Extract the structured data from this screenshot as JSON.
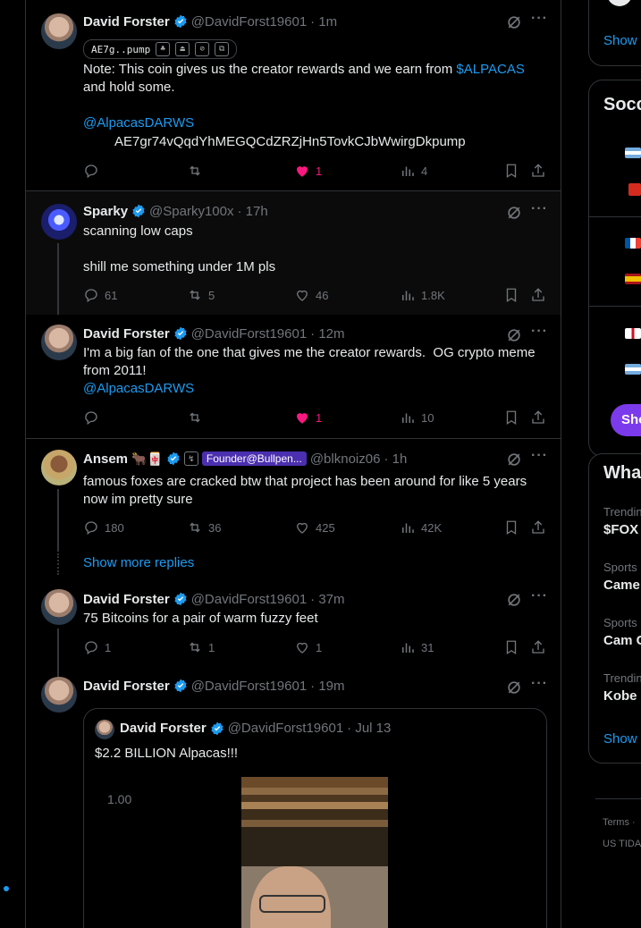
{
  "feed": {
    "tweets": [
      {
        "name": "David Forster",
        "handle": "@DavidForst19601",
        "time": "· 1m",
        "pump_label": "AE7g..pump",
        "text1": "Note: This coin gives us the creator rewards and we earn from ",
        "text1_link": "$ALPACAS",
        "text1_end": "and hold some.",
        "mention": "@AlpacasDARWS",
        "contract": "AE7gr74vQqdYhMEGQCdZRZjHn5TovkCJbWwirgDkpump",
        "replies": "",
        "reposts": "",
        "likes": "1",
        "views": "4"
      },
      {
        "name": "Sparky",
        "handle": "@Sparky100x",
        "time": "· 17h",
        "line1": "scanning low caps",
        "line2": "shill me something under 1M pls",
        "replies": "61",
        "reposts": "5",
        "likes": "46",
        "views": "1.8K"
      },
      {
        "name": "David Forster",
        "handle": "@DavidForst19601",
        "time": "· 12m",
        "text": "I'm a big fan of the one that gives me the creator rewards.  OG crypto meme from 2011!",
        "mention": "@AlpacasDARWS",
        "replies": "",
        "reposts": "",
        "likes": "1",
        "views": "10"
      },
      {
        "name": "Ansem",
        "emoji": "🐂🀄",
        "tag": "Founder@Bullpen...",
        "handle": "@blknoiz06",
        "time": "· 1h",
        "text": "famous foxes are cracked btw that project has been around for like 5 years now im pretty sure",
        "replies": "180",
        "reposts": "36",
        "likes": "425",
        "views": "42K"
      },
      {
        "name": "David Forster",
        "handle": "@DavidForst19601",
        "time": "· 37m",
        "text": "75 Bitcoins for a pair of warm fuzzy feet",
        "replies": "1",
        "reposts": "1",
        "likes": "1",
        "views": "31"
      },
      {
        "name": "David Forster",
        "handle": "@DavidForst19601",
        "time": "· 19m"
      }
    ],
    "show_more_replies": "Show more replies",
    "quote": {
      "name": "David Forster",
      "handle": "@DavidForst19601",
      "time": "· Jul 13",
      "text": "$2.2 BILLION Alpacas!!!",
      "chart_label": "1.00"
    }
  },
  "sidebar": {
    "show_top": "Show",
    "soccer_title": "Socc",
    "show_btn": "Sho",
    "whats_title": "Wha",
    "trends": [
      {
        "category": "Trendin",
        "title": "$FOX"
      },
      {
        "category": "Sports",
        "title": "Came"
      },
      {
        "category": "Sports",
        "title": "Cam C"
      },
      {
        "category": "Trendin",
        "title": "Kobe S"
      }
    ],
    "show_bottom": "Show",
    "terms": "Terms  ·",
    "us_tidal": "US TIDA"
  },
  "colors": {
    "accent": "#1d9bf0",
    "like": "#f91880",
    "purple": "#7c3aed",
    "background": "#000000"
  }
}
